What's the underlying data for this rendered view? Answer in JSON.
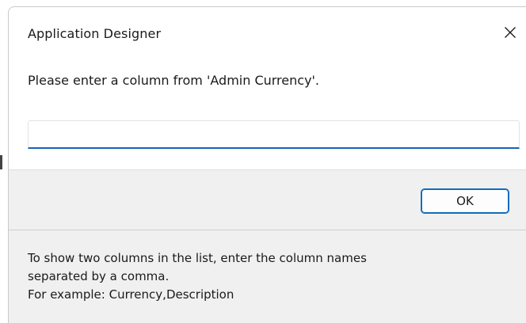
{
  "window": {
    "title": "Application Designer",
    "close_icon": "close-icon"
  },
  "prompt": {
    "text": "Please enter a column from 'Admin Currency'."
  },
  "input": {
    "value": "",
    "placeholder": ""
  },
  "buttons": {
    "ok_label": "OK"
  },
  "hint": {
    "lines": [
      "To show two columns in the list, enter the column names",
      "separated by a comma.",
      "For example: Currency,Description"
    ]
  },
  "colors": {
    "accent": "#0f6cbd",
    "input_underline": "#1a62b8",
    "band_background": "#f0f0f0"
  }
}
